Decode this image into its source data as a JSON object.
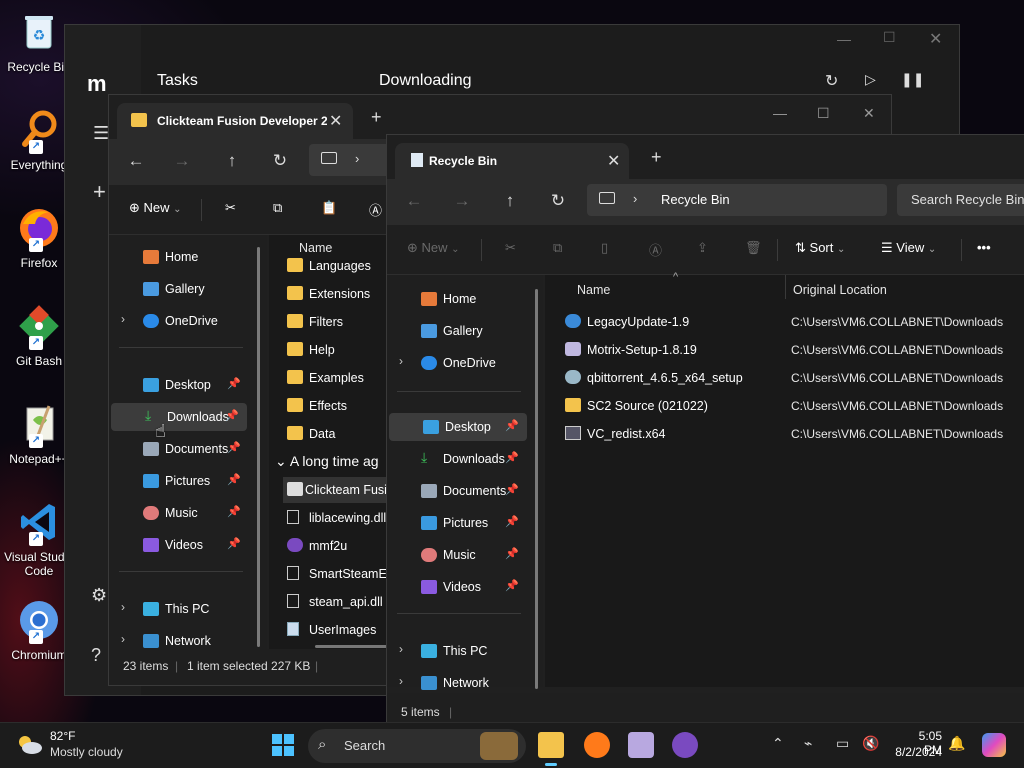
{
  "desktop": {
    "icons": [
      {
        "label": "Recycle Bin"
      },
      {
        "label": "Everything"
      },
      {
        "label": "Firefox"
      },
      {
        "label": "Git Bash"
      },
      {
        "label": "Notepad++"
      },
      {
        "label": "Visual Studio Code"
      },
      {
        "label": "Chromium"
      }
    ]
  },
  "tasks_window": {
    "title": "Tasks",
    "section": "Downloading"
  },
  "clickteam_window": {
    "tab_title": "Clickteam Fusion Developer 2.",
    "toolbar": {
      "new_label": "New"
    },
    "nav": {
      "home": "Home",
      "gallery": "Gallery",
      "onedrive": "OneDrive",
      "desktop": "Desktop",
      "downloads": "Downloads",
      "documents": "Documents",
      "pictures": "Pictures",
      "music": "Music",
      "videos": "Videos",
      "thispc": "This PC",
      "network": "Network"
    },
    "column_name": "Name",
    "files": [
      {
        "name": "Languages",
        "type": "folder"
      },
      {
        "name": "Extensions",
        "type": "folder"
      },
      {
        "name": "Filters",
        "type": "folder"
      },
      {
        "name": "Help",
        "type": "folder"
      },
      {
        "name": "Examples",
        "type": "folder"
      },
      {
        "name": "Effects",
        "type": "folder"
      },
      {
        "name": "Data",
        "type": "folder"
      }
    ],
    "group_label": "A long time ag",
    "older_files": [
      {
        "name": "Clickteam Fusi",
        "type": "app"
      },
      {
        "name": "liblacewing.dll",
        "type": "file"
      },
      {
        "name": "mmf2u",
        "type": "app2"
      },
      {
        "name": "SmartSteamEm",
        "type": "file"
      },
      {
        "name": "steam_api.dll",
        "type": "file"
      },
      {
        "name": "UserImages",
        "type": "file2"
      }
    ],
    "status": {
      "count": "23 items",
      "selection": "1 item selected  227 KB"
    }
  },
  "recycle_window": {
    "tab_title": "Recycle Bin",
    "breadcrumb": "Recycle Bin",
    "search_placeholder": "Search Recycle Bin",
    "toolbar": {
      "new_label": "New",
      "sort_label": "Sort",
      "view_label": "View",
      "more_label": "•••"
    },
    "nav": {
      "home": "Home",
      "gallery": "Gallery",
      "onedrive": "OneDrive",
      "desktop": "Desktop",
      "downloads": "Downloads",
      "documents": "Documents",
      "pictures": "Pictures",
      "music": "Music",
      "videos": "Videos",
      "thispc": "This PC",
      "network": "Network"
    },
    "columns": {
      "name": "Name",
      "location": "Original Location"
    },
    "items": [
      {
        "name": "LegacyUpdate-1.9",
        "location": "C:\\Users\\VM6.COLLABNET\\Downloads",
        "icon": "globe"
      },
      {
        "name": "Motrix-Setup-1.8.19",
        "location": "C:\\Users\\VM6.COLLABNET\\Downloads",
        "icon": "installer"
      },
      {
        "name": "qbittorrent_4.6.5_x64_setup",
        "location": "C:\\Users\\VM6.COLLABNET\\Downloads",
        "icon": "qb"
      },
      {
        "name": "SC2 Source (021022)",
        "location": "C:\\Users\\VM6.COLLABNET\\Downloads",
        "icon": "folder"
      },
      {
        "name": "VC_redist.x64",
        "location": "C:\\Users\\VM6.COLLABNET\\Downloads",
        "icon": "vc"
      }
    ],
    "status": {
      "count": "5 items"
    }
  },
  "taskbar": {
    "weather": {
      "temp": "82°F",
      "desc": "Mostly cloudy"
    },
    "search_label": "Search",
    "clock": {
      "time": "5:05 PM",
      "date": "8/2/2024"
    }
  },
  "colors": {
    "accent": "#60cdff",
    "folder": "#f3c34c",
    "window_bg": "#202020",
    "taskbar_bg": "#1c1c1c"
  }
}
